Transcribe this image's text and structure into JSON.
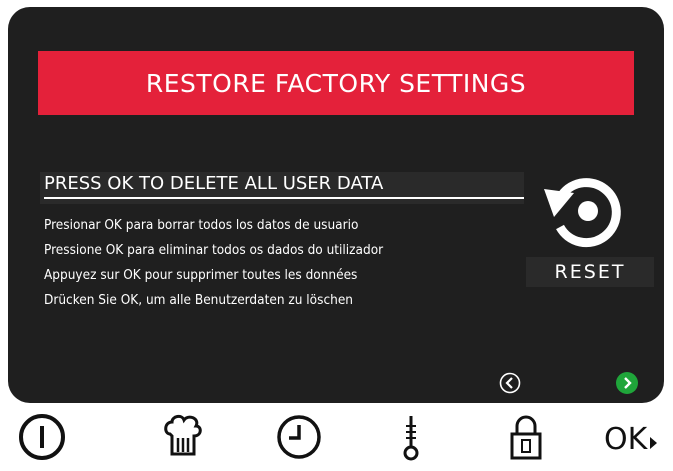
{
  "banner": {
    "title": "RESTORE FACTORY SETTINGS"
  },
  "message": {
    "headline": "PRESS OK TO DELETE ALL USER DATA",
    "lines": [
      "Presionar OK para borrar todos los datos de usuario",
      "Pressione OK para eliminar todos os dados do utilizador",
      "Appuyez sur OK pour supprimer toutes les données",
      "Drücken Sie OK, um alle Benutzerdaten zu löschen"
    ]
  },
  "reset": {
    "label": "RESET",
    "icon": "reset-icon"
  },
  "navigation": {
    "prev_icon": "chevron-left-icon",
    "next_icon": "chevron-right-icon",
    "next_color": "#1fa53a"
  },
  "keys": {
    "power_icon": "power-icon",
    "chef_hat_icon": "chef-hat-icon",
    "clock_icon": "clock-icon",
    "thermometer_icon": "thermometer-icon",
    "lock_icon": "lock-icon",
    "ok_label": "OK"
  },
  "colors": {
    "banner": "#e4213a",
    "screen": "#1f1f1f",
    "text": "#ffffff"
  }
}
